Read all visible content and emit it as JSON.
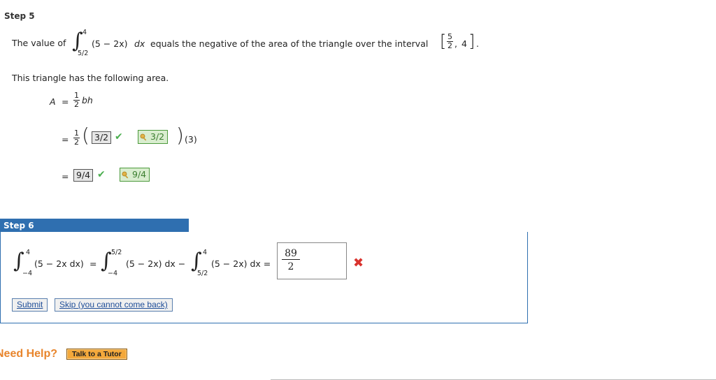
{
  "step5": {
    "title": "Step 5",
    "sentence_pre": "The value of",
    "int_upper": "4",
    "int_lower": "5/2",
    "integrand": "(5 − 2x)",
    "dx": "dx",
    "sentence_mid": "equals the negative of the area of the triangle over the interval",
    "interval_num": "5",
    "interval_den": "2",
    "interval_right": "4",
    "period": ".",
    "area_sentence": "This triangle has the following area.",
    "formula_lhs": "A",
    "equals": "=",
    "half_num": "1",
    "half_den": "2",
    "formula_bh": "bh",
    "line2_answer": "3/2",
    "line2_key": "3/2",
    "line2_factor": "(3)",
    "line3_answer": "9/4",
    "line3_key": "9/4"
  },
  "step6": {
    "title": "Step 6",
    "int1_upper": "4",
    "int1_lower": "−4",
    "int1_body": "(5 − 2x dx)",
    "eq": "=",
    "int2_upper": "5/2",
    "int2_lower": "−4",
    "int2_body": "(5 − 2x) dx −",
    "int3_upper": "4",
    "int3_lower": "5/2",
    "int3_body": "(5 − 2x) dx =",
    "answer_num": "89",
    "answer_den": "2",
    "submit_label": "Submit",
    "skip_label": "Skip (you cannot come back)"
  },
  "help": {
    "need_help": "Need Help?",
    "tutor_label": "Talk to a Tutor"
  },
  "icons": {
    "check": "check-icon",
    "key": "key-icon",
    "wrong": "x-mark-icon"
  },
  "colors": {
    "step_bar": "#2f6fb0",
    "correct": "#4caf50",
    "key_box": "#d9edcf",
    "wrong": "#d9332e",
    "need_help": "#e8852c",
    "tutor_button": "#f3a83b"
  }
}
